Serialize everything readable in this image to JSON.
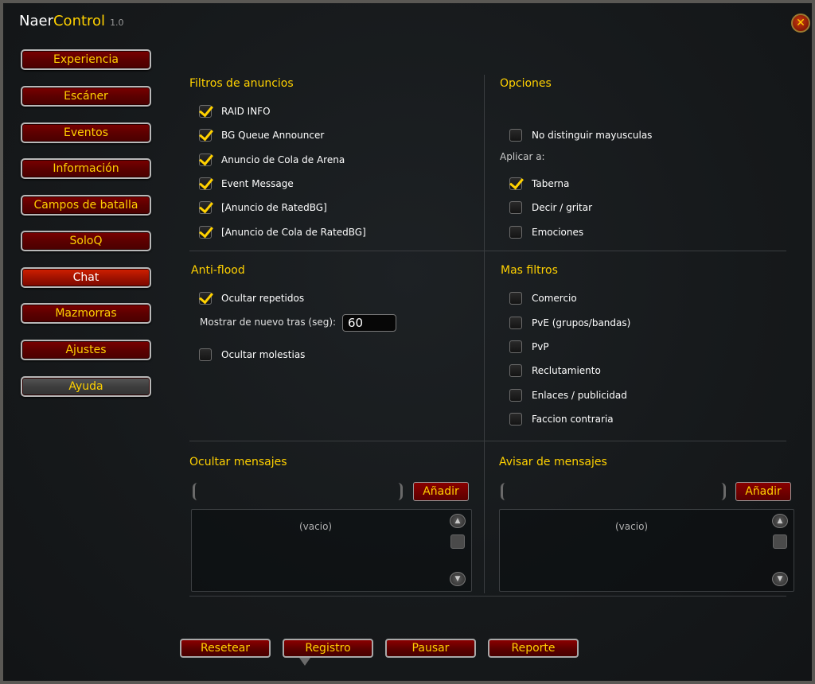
{
  "window": {
    "title_part1": "Naer",
    "title_part2": "Control",
    "version": "1.0",
    "close_glyph": "✕"
  },
  "sidebar": {
    "items": [
      {
        "label": "Experiencia",
        "state": "normal"
      },
      {
        "label": "Escáner",
        "state": "normal"
      },
      {
        "label": "Eventos",
        "state": "normal"
      },
      {
        "label": "Información",
        "state": "normal"
      },
      {
        "label": "Campos de batalla",
        "state": "normal"
      },
      {
        "label": "SoloQ",
        "state": "normal"
      },
      {
        "label": "Chat",
        "state": "active"
      },
      {
        "label": "Mazmorras",
        "state": "normal"
      },
      {
        "label": "Ajustes",
        "state": "normal"
      },
      {
        "label": "Ayuda",
        "state": "grey"
      }
    ]
  },
  "filtros_anuncios": {
    "title": "Filtros de anuncios",
    "items": [
      {
        "label": "RAID INFO",
        "checked": true
      },
      {
        "label": "BG Queue Announcer",
        "checked": true
      },
      {
        "label": "Anuncio de Cola de Arena",
        "checked": true
      },
      {
        "label": "Event Message",
        "checked": true
      },
      {
        "label": "[Anuncio de RatedBG]",
        "checked": true
      },
      {
        "label": "[Anuncio de Cola de RatedBG]",
        "checked": true
      }
    ]
  },
  "opciones": {
    "title": "Opciones",
    "no_distinguir": {
      "label": "No distinguir mayusculas",
      "checked": false
    },
    "aplicar_label": "Aplicar a:",
    "aplicar": [
      {
        "label": "Taberna",
        "checked": true
      },
      {
        "label": "Decir / gritar",
        "checked": false
      },
      {
        "label": "Emociones",
        "checked": false
      }
    ]
  },
  "antiflood": {
    "title": "Anti-flood",
    "ocultar_repetidos": {
      "label": "Ocultar repetidos",
      "checked": true
    },
    "mostrar_label": "Mostrar de nuevo tras (seg):",
    "mostrar_value": "60",
    "ocultar_molestias": {
      "label": "Ocultar molestias",
      "checked": false
    }
  },
  "mas_filtros": {
    "title": "Mas filtros",
    "items": [
      {
        "label": "Comercio",
        "checked": false
      },
      {
        "label": "PvE (grupos/bandas)",
        "checked": false
      },
      {
        "label": "PvP",
        "checked": false
      },
      {
        "label": "Reclutamiento",
        "checked": false
      },
      {
        "label": "Enlaces / publicidad",
        "checked": false
      },
      {
        "label": "Faccion contraria",
        "checked": false
      }
    ]
  },
  "ocultar_mensajes": {
    "title": "Ocultar mensajes",
    "input_value": "",
    "add_label": "Añadir",
    "empty_text": "(vacio)"
  },
  "avisar_mensajes": {
    "title": "Avisar de mensajes",
    "input_value": "",
    "add_label": "Añadir",
    "empty_text": "(vacio)"
  },
  "bottom_buttons": [
    {
      "label": "Resetear"
    },
    {
      "label": "Registro"
    },
    {
      "label": "Pausar"
    },
    {
      "label": "Reporte"
    }
  ],
  "icons": {
    "scroll_up": "scroll-up-icon",
    "scroll_down": "scroll-down-icon",
    "close": "close-icon",
    "checkmark": "checkmark-icon"
  },
  "colors": {
    "accent_gold": "#ffd100",
    "button_red": "#6a0000",
    "active_red": "#c01800"
  }
}
